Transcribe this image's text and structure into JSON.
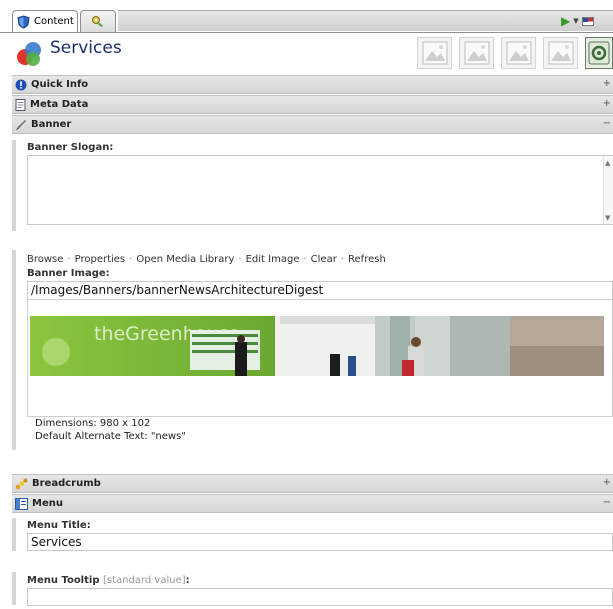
{
  "tabs": [
    {
      "label": "Content",
      "icon": "shield-icon",
      "active": true
    },
    {
      "label": "",
      "icon": "key-icon",
      "active": false
    }
  ],
  "page": {
    "title": "Services",
    "icon": "services-logo-icon"
  },
  "toolbar_thumbs": [
    "image-placeholder-icon",
    "image-placeholder-icon",
    "image-placeholder-icon",
    "image-placeholder-icon",
    "gear-icon"
  ],
  "sections": {
    "quick_info": {
      "label": "Quick Info",
      "icon": "info-icon",
      "toggle": "+"
    },
    "meta_data": {
      "label": "Meta Data",
      "icon": "document-icon",
      "toggle": "+"
    },
    "banner": {
      "label": "Banner",
      "icon": "brush-icon",
      "toggle": "−"
    },
    "breadcrumb": {
      "label": "Breadcrumb",
      "icon": "breadcrumb-icon",
      "toggle": "+"
    },
    "menu": {
      "label": "Menu",
      "icon": "menu-icon",
      "toggle": "−"
    }
  },
  "banner": {
    "slogan_label": "Banner Slogan:",
    "slogan_value": "",
    "actions": [
      "Browse",
      "Properties",
      "Open Media Library",
      "Edit Image",
      "Clear",
      "Refresh"
    ],
    "image_label": "Banner Image:",
    "image_path": "/Images/Banners/bannerNewsArchitectureDigest",
    "dimensions": "Dimensions: 980 x 102",
    "alt_text": "Default Alternate Text: \"news\"",
    "brand_text": "theGreenhouse"
  },
  "menu": {
    "title_label": "Menu Title:",
    "title_value": "Services",
    "tooltip_label": "Menu Tooltip",
    "tooltip_std": "[standard value]",
    "tooltip_colon": ":",
    "tooltip_value": ""
  },
  "colors": {
    "title": "#1d2e6b",
    "section_bar": "#dedede",
    "banner_green": "#7ab23a"
  }
}
